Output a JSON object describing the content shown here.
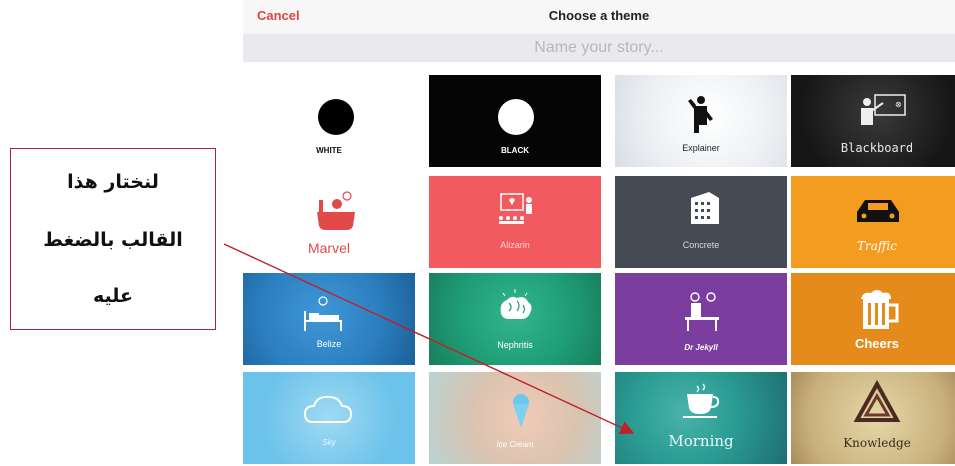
{
  "header": {
    "cancel_label": "Cancel",
    "title": "Choose a theme"
  },
  "story_name": {
    "placeholder": "Name your story..."
  },
  "themes": [
    {
      "label": "WHITE",
      "icon": "filled-circle-icon",
      "bg": "#ffffff",
      "fg": "#111111"
    },
    {
      "label": "BLACK",
      "icon": "filled-circle-icon",
      "bg": "#0c0c0c",
      "fg": "#ffffff"
    },
    {
      "label": "Explainer",
      "icon": "figure-icon",
      "bg": "#eef1f4",
      "fg": "#222222"
    },
    {
      "label": "Blackboard",
      "icon": "teacher-board-icon",
      "bg": "#1c1c1c",
      "fg": "#e8e8e8"
    },
    {
      "label": "Marvel",
      "icon": "bathtub-idea-icon",
      "bg": "#ffffff",
      "fg": "#e24a4a"
    },
    {
      "label": "Alizarin",
      "icon": "presentation-audience-icon",
      "bg": "#f25a5f",
      "fg": "#ffffff"
    },
    {
      "label": "Concrete",
      "icon": "building-icon",
      "bg": "#454a55",
      "fg": "#ffffff"
    },
    {
      "label": "Traffic",
      "icon": "car-icon",
      "bg": "#f39c1f",
      "fg": "#ffffff"
    },
    {
      "label": "Belize",
      "icon": "bed-idea-icon",
      "bg": "#2c7fc0",
      "fg": "#ffffff"
    },
    {
      "label": "Nephritis",
      "icon": "brain-icon",
      "bg": "#1f9e76",
      "fg": "#ffffff"
    },
    {
      "label": "Dr Jekyll",
      "icon": "scientist-icon",
      "bg": "#7b3d9e",
      "fg": "#ffffff"
    },
    {
      "label": "Cheers",
      "icon": "beer-mug-icon",
      "bg": "#e58b1c",
      "fg": "#ffffff"
    },
    {
      "label": "Sky",
      "icon": "cloud-icon",
      "bg": "#6bc2ea",
      "fg": "#ffffff"
    },
    {
      "label": "Ice Cream",
      "icon": "ice-cream-icon",
      "bg": "#e6b9a5",
      "fg": "#ffffff"
    },
    {
      "label": "Morning",
      "icon": "coffee-cup-icon",
      "bg": "#2a9c93",
      "fg": "#ffffff"
    },
    {
      "label": "Knowledge",
      "icon": "triangle-logo-icon",
      "bg": "#d7c38f",
      "fg": "#3a2a1a"
    }
  ],
  "annotation": {
    "lines": [
      "لنختار هذا",
      "القالب بالضغط",
      "عليه"
    ],
    "border_color": "#a6243a",
    "arrow_color": "#c0202a"
  }
}
